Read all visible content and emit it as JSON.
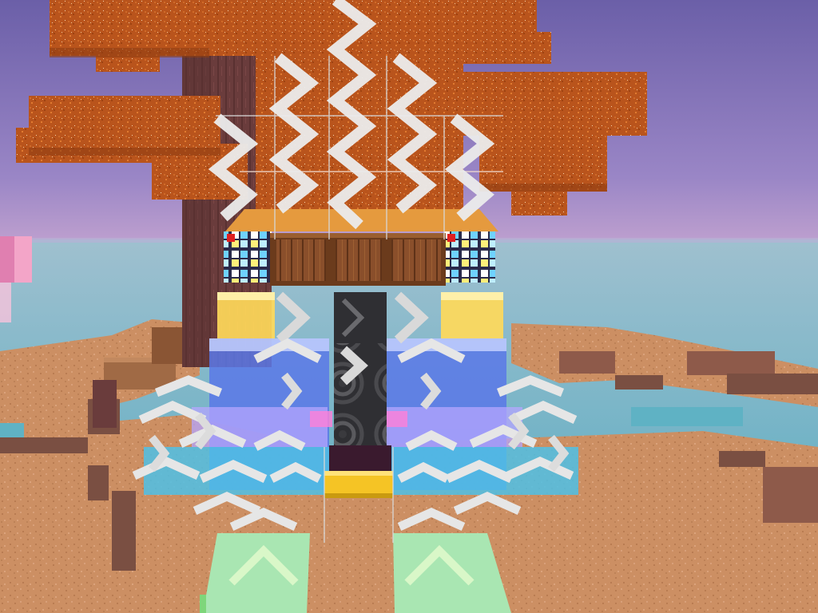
{
  "scene": {
    "type": "voxel-sandbox-game",
    "palette": {
      "sky_top": "#6b5fa8",
      "sky_mid": "#9a86c6",
      "sky_horizon": "#c4a4d0",
      "ocean": "#5fb2c4",
      "terrain": "#cc8f63",
      "terrain_shadow": "#7a4f42",
      "leaves": "#b9541c",
      "trunk": "#6a3c3c",
      "plank": "#8a4f2b",
      "gold": "#f5c425",
      "crystal_blue": "#5a78e8",
      "crystal_yellow": "#ffd95a",
      "speaker": "#2f2f33",
      "chevron": "#ebebeb",
      "green_block": "#a9e6b2"
    },
    "objects": [
      {
        "name": "autumn-tree",
        "kind": "tree"
      },
      {
        "name": "wooden-shelf",
        "kind": "block"
      },
      {
        "name": "speaker-pillar",
        "kind": "block"
      },
      {
        "name": "gold-block",
        "kind": "block"
      },
      {
        "name": "stained-glass-blocks",
        "kind": "block"
      },
      {
        "name": "wind-particles",
        "kind": "particle-effect"
      },
      {
        "name": "green-chevron-blocks",
        "kind": "block"
      }
    ]
  }
}
